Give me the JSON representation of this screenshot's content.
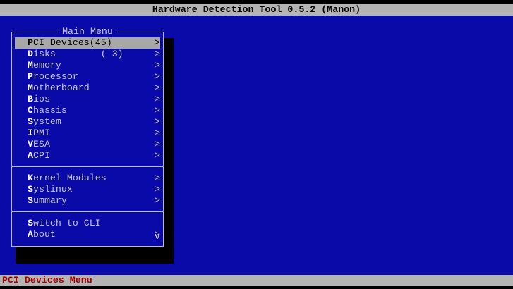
{
  "title": "Hardware Detection Tool 0.5.2 (Manon)",
  "menu": {
    "title": "Main Menu",
    "groups": [
      [
        {
          "hotkey": "P",
          "rest": "CI Devices(45)",
          "arrow": ">"
        },
        {
          "hotkey": "D",
          "rest": "isks        ( 3)",
          "arrow": ">"
        },
        {
          "hotkey": "M",
          "rest": "emory",
          "arrow": ">"
        },
        {
          "hotkey": "P",
          "rest": "rocessor",
          "arrow": ">"
        },
        {
          "hotkey": "M",
          "rest": "otherboard",
          "arrow": ">"
        },
        {
          "hotkey": "B",
          "rest": "ios",
          "arrow": ">"
        },
        {
          "hotkey": "C",
          "rest": "hassis",
          "arrow": ">"
        },
        {
          "hotkey": "S",
          "rest": "ystem",
          "arrow": ">"
        },
        {
          "hotkey": "I",
          "rest": "PMI",
          "arrow": ">"
        },
        {
          "hotkey": "V",
          "rest": "ESA",
          "arrow": ">"
        },
        {
          "hotkey": "A",
          "rest": "CPI",
          "arrow": ">"
        }
      ],
      [
        {
          "hotkey": "K",
          "rest": "ernel Modules",
          "arrow": ">"
        },
        {
          "hotkey": "S",
          "rest": "yslinux",
          "arrow": ">"
        },
        {
          "hotkey": "S",
          "rest": "ummary",
          "arrow": ">"
        }
      ],
      [
        {
          "hotkey": "S",
          "rest": "witch to CLI",
          "arrow": ""
        },
        {
          "hotkey": "A",
          "rest": "bout",
          "arrow": ">"
        }
      ]
    ],
    "scroll_indicator": "v"
  },
  "status": "PCI Devices Menu"
}
